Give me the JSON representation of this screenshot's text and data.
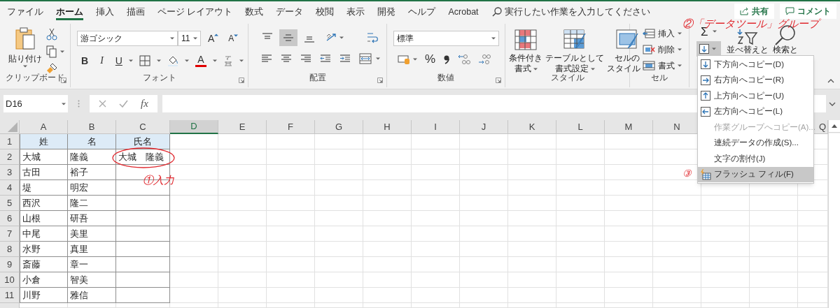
{
  "tabs": [
    {
      "label": "ファイル",
      "selected": false
    },
    {
      "label": "ホーム",
      "selected": true
    },
    {
      "label": "挿入",
      "selected": false
    },
    {
      "label": "描画",
      "selected": false
    },
    {
      "label": "ページ レイアウト",
      "selected": false
    },
    {
      "label": "数式",
      "selected": false
    },
    {
      "label": "データ",
      "selected": false
    },
    {
      "label": "校閲",
      "selected": false
    },
    {
      "label": "表示",
      "selected": false
    },
    {
      "label": "開発",
      "selected": false
    },
    {
      "label": "ヘルプ",
      "selected": false
    },
    {
      "label": "Acrobat",
      "selected": false
    }
  ],
  "tell_me": {
    "placeholder": "実行したい作業を入力してください"
  },
  "share_button": "共有",
  "comment_button": "コメント",
  "ribbon": {
    "clipboard": {
      "label": "クリップボード",
      "paste": "貼り付け"
    },
    "font": {
      "label": "フォント",
      "font_name": "游ゴシック",
      "font_size": "11",
      "grow": "A",
      "shrink": "A",
      "bold": "B",
      "italic": "I",
      "underline": "U",
      "font_color": "A"
    },
    "alignment": {
      "label": "配置",
      "vertical": [
        {
          "kind": "top",
          "selected": false
        },
        {
          "kind": "middle",
          "selected": true
        },
        {
          "kind": "bottom",
          "selected": false
        }
      ]
    },
    "number": {
      "label": "数値",
      "format": "標準",
      "percent": "%"
    },
    "styles": {
      "label": "スタイル",
      "buttons": [
        {
          "kind": "conditional",
          "lines": [
            "条件付き",
            "書式"
          ]
        },
        {
          "kind": "table",
          "lines": [
            "テーブルとして",
            "書式設定"
          ]
        },
        {
          "kind": "cell",
          "lines": [
            "セルの",
            "スタイル"
          ]
        }
      ]
    },
    "cells": {
      "label": "セル",
      "buttons": [
        {
          "kind": "insert",
          "label": "挿入"
        },
        {
          "kind": "delete",
          "label": "削除"
        },
        {
          "kind": "format",
          "label": "書式"
        }
      ]
    },
    "editing": {
      "autosum": "Σ",
      "fill_pressed": true,
      "sort": "並べ替えと",
      "find": "検索と"
    }
  },
  "formula_bar": {
    "name_box": "D16",
    "function_label": "fx"
  },
  "sheet": {
    "columns": [
      {
        "label": "A",
        "selected": false
      },
      {
        "label": "B",
        "selected": false
      },
      {
        "label": "C",
        "selected": false
      },
      {
        "label": "D",
        "selected": true
      },
      {
        "label": "E",
        "selected": false
      },
      {
        "label": "F",
        "selected": false
      },
      {
        "label": "G",
        "selected": false
      },
      {
        "label": "H",
        "selected": false
      },
      {
        "label": "I",
        "selected": false
      },
      {
        "label": "J",
        "selected": false
      },
      {
        "label": "K",
        "selected": false
      },
      {
        "label": "L",
        "selected": false
      },
      {
        "label": "M",
        "selected": false
      },
      {
        "label": "N",
        "selected": false
      },
      {
        "label": "Q",
        "selected": false
      }
    ],
    "rows": [
      {
        "number": "1",
        "kind": "header",
        "cells": [
          "姓",
          "名",
          "氏名"
        ]
      },
      {
        "number": "2",
        "kind": "data",
        "cells": [
          "大城",
          "隆義",
          "大城　隆義"
        ]
      },
      {
        "number": "3",
        "kind": "data",
        "cells": [
          "古田",
          "裕子"
        ]
      },
      {
        "number": "4",
        "kind": "data",
        "cells": [
          "堤",
          "明宏"
        ]
      },
      {
        "number": "5",
        "kind": "data",
        "cells": [
          "西沢",
          "隆二"
        ]
      },
      {
        "number": "6",
        "kind": "data",
        "cells": [
          "山根",
          "研吾"
        ]
      },
      {
        "number": "7",
        "kind": "data",
        "cells": [
          "中尾",
          "美里"
        ]
      },
      {
        "number": "8",
        "kind": "data",
        "cells": [
          "水野",
          "真里"
        ]
      },
      {
        "number": "9",
        "kind": "data",
        "cells": [
          "斎藤",
          "章一"
        ]
      },
      {
        "number": "10",
        "kind": "data",
        "cells": [
          "小倉",
          "智美"
        ]
      },
      {
        "number": "11",
        "kind": "data",
        "cells": [
          "川野",
          "雅信"
        ]
      }
    ]
  },
  "fill_menu": [
    {
      "kind": "down",
      "label": "下方向へコピー(D)",
      "disabled": false,
      "selected": false
    },
    {
      "kind": "right",
      "label": "右方向へコピー(R)",
      "disabled": false,
      "selected": false
    },
    {
      "kind": "up",
      "label": "上方向へコピー(U)",
      "disabled": false,
      "selected": false
    },
    {
      "kind": "left",
      "label": "左方向へコピー(L)",
      "disabled": false,
      "selected": false
    },
    {
      "kind": "plain",
      "label": "作業グループへコピー(A)...",
      "disabled": true,
      "selected": false
    },
    {
      "kind": "plain",
      "label": "連続データの作成(S)...",
      "disabled": false,
      "selected": false
    },
    {
      "kind": "plain",
      "label": "文字の割付(J)",
      "disabled": false,
      "selected": false
    },
    {
      "kind": "flash",
      "label": "フラッシュ フィル(F)",
      "disabled": false,
      "selected": true
    }
  ],
  "annotations": [
    {
      "text": "①入力"
    },
    {
      "text": "②「データツール」グループ"
    },
    {
      "text": "③"
    }
  ]
}
